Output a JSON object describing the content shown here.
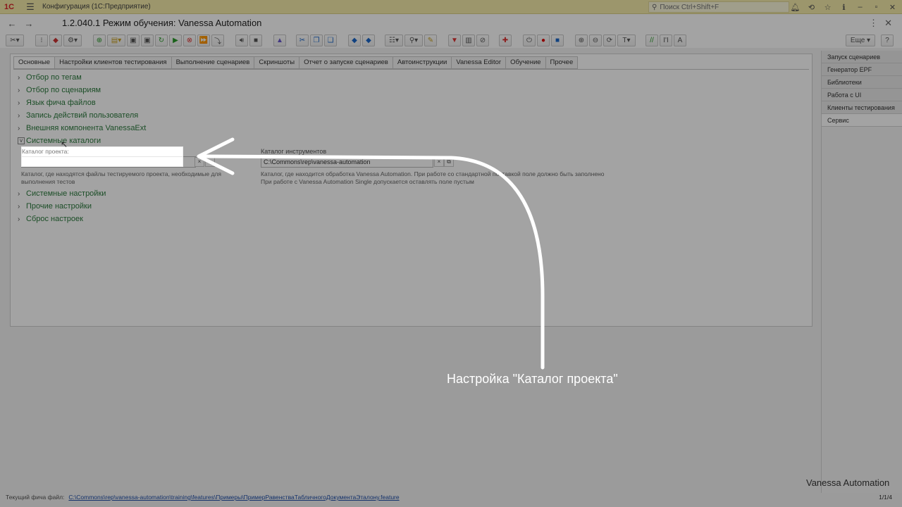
{
  "titlebar": {
    "app_title": "Конфигурация  (1С:Предприятие)",
    "search_placeholder": "Поиск Ctrl+Shift+F"
  },
  "form": {
    "title": "1.2.040.1 Режим обучения: Vanessa Automation"
  },
  "cmdbar": {
    "more_label": "Еще",
    "help_label": "?"
  },
  "tabs": [
    "Основные",
    "Настройки клиентов тестирования",
    "Выполнение сценариев",
    "Скриншоты",
    "Отчет о запуске сценариев",
    "Автоинструкции",
    "Vanessa Editor",
    "Обучение",
    "Прочее"
  ],
  "groups_top": [
    "Отбор по тегам",
    "Отбор по сценариям",
    "Язык фича файлов",
    "Запись действий пользователя",
    "Внешняя компонента VanessaExt"
  ],
  "open_group": "Системные каталоги",
  "fields": {
    "project": {
      "label": "Каталог проекта:",
      "value": "",
      "hint": "Каталог, где находятся файлы тестируемого проекта, необходимые для выполнения тестов"
    },
    "tools": {
      "label": "Каталог инструментов",
      "value": "C:\\Commons\\rep\\vanessa-automation",
      "hint_line1": "Каталог, где находится обработка Vanessa Automation. При работе со стандартной поставкой поле должно быть заполнено",
      "hint_line2": "При работе с Vanessa Automation Single допускается оставлять поле пустым"
    }
  },
  "groups_bottom": [
    "Системные настройки",
    "Прочие настройки",
    "Сброс настроек"
  ],
  "right_panel": [
    "Запуск сценариев",
    "Генератор EPF",
    "Библиотеки",
    "Работа с UI",
    "Клиенты тестирования",
    "Сервис"
  ],
  "status": {
    "label": "Текущий фича файл:",
    "path": "C:\\Commons\\rep\\vanessa-automation\\training\\features\\Примеры\\ПримерРавенстваТабличногоДокументаЭталону.feature",
    "page": "1/1/4"
  },
  "overlay": {
    "caption": "Настройка \"Каталог проекта\"",
    "watermark": "Vanessa Automation"
  },
  "colors": {
    "titlebar": "#f4eba9",
    "group_link": "#2c7a3e",
    "overlay_arrow": "#ffffff"
  }
}
